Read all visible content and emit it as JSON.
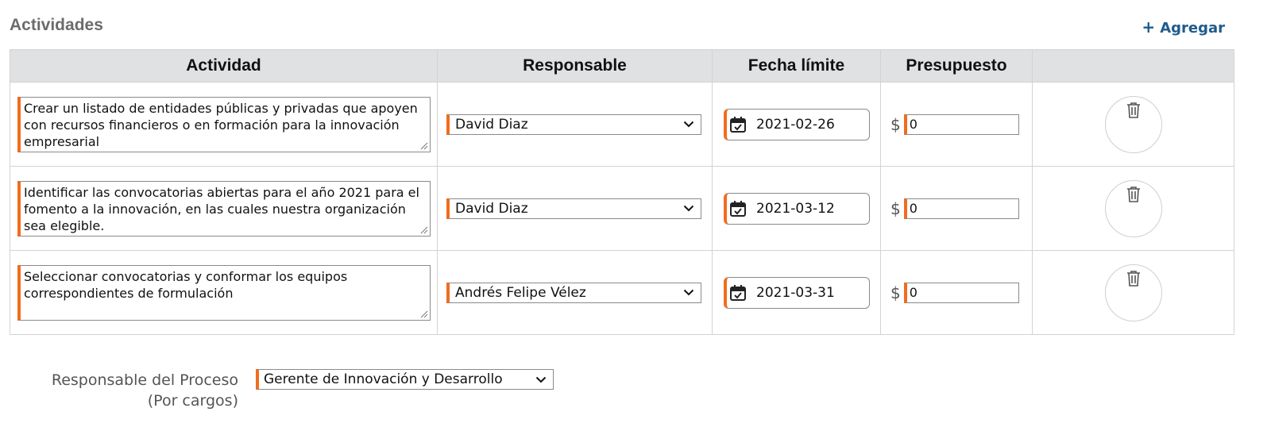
{
  "section": {
    "title": "Actividades",
    "add_label": "Agregar",
    "add_icon": "plus-icon"
  },
  "table": {
    "headers": [
      "Actividad",
      "Responsable",
      "Fecha límite",
      "Presupuesto",
      ""
    ],
    "rows": [
      {
        "activity": "Crear un listado de entidades públicas y privadas que apoyen con recursos financieros o en formación para la innovación empresarial",
        "responsible": "David Diaz",
        "deadline": "2021-02-26",
        "currency": "$",
        "budget": "0"
      },
      {
        "activity": "Identificar las convocatorias abiertas para el año 2021 para el fomento a la innovación, en las cuales nuestra organización sea elegible.",
        "responsible": "David Diaz",
        "deadline": "2021-03-12",
        "currency": "$",
        "budget": "0"
      },
      {
        "activity": "Seleccionar convocatorias y conformar los equipos correspondientes de formulación",
        "responsible": "Andrés Felipe Vélez",
        "deadline": "2021-03-31",
        "currency": "$",
        "budget": "0"
      }
    ]
  },
  "process_owner": {
    "label_line1": "Responsable del Proceso",
    "label_line2": "(Por cargos)",
    "value": "Gerente de Innovación y Desarrollo"
  },
  "colors": {
    "accent": "#f26c1d",
    "link": "#1f5b8c",
    "header_bg": "#e0e1e3"
  }
}
